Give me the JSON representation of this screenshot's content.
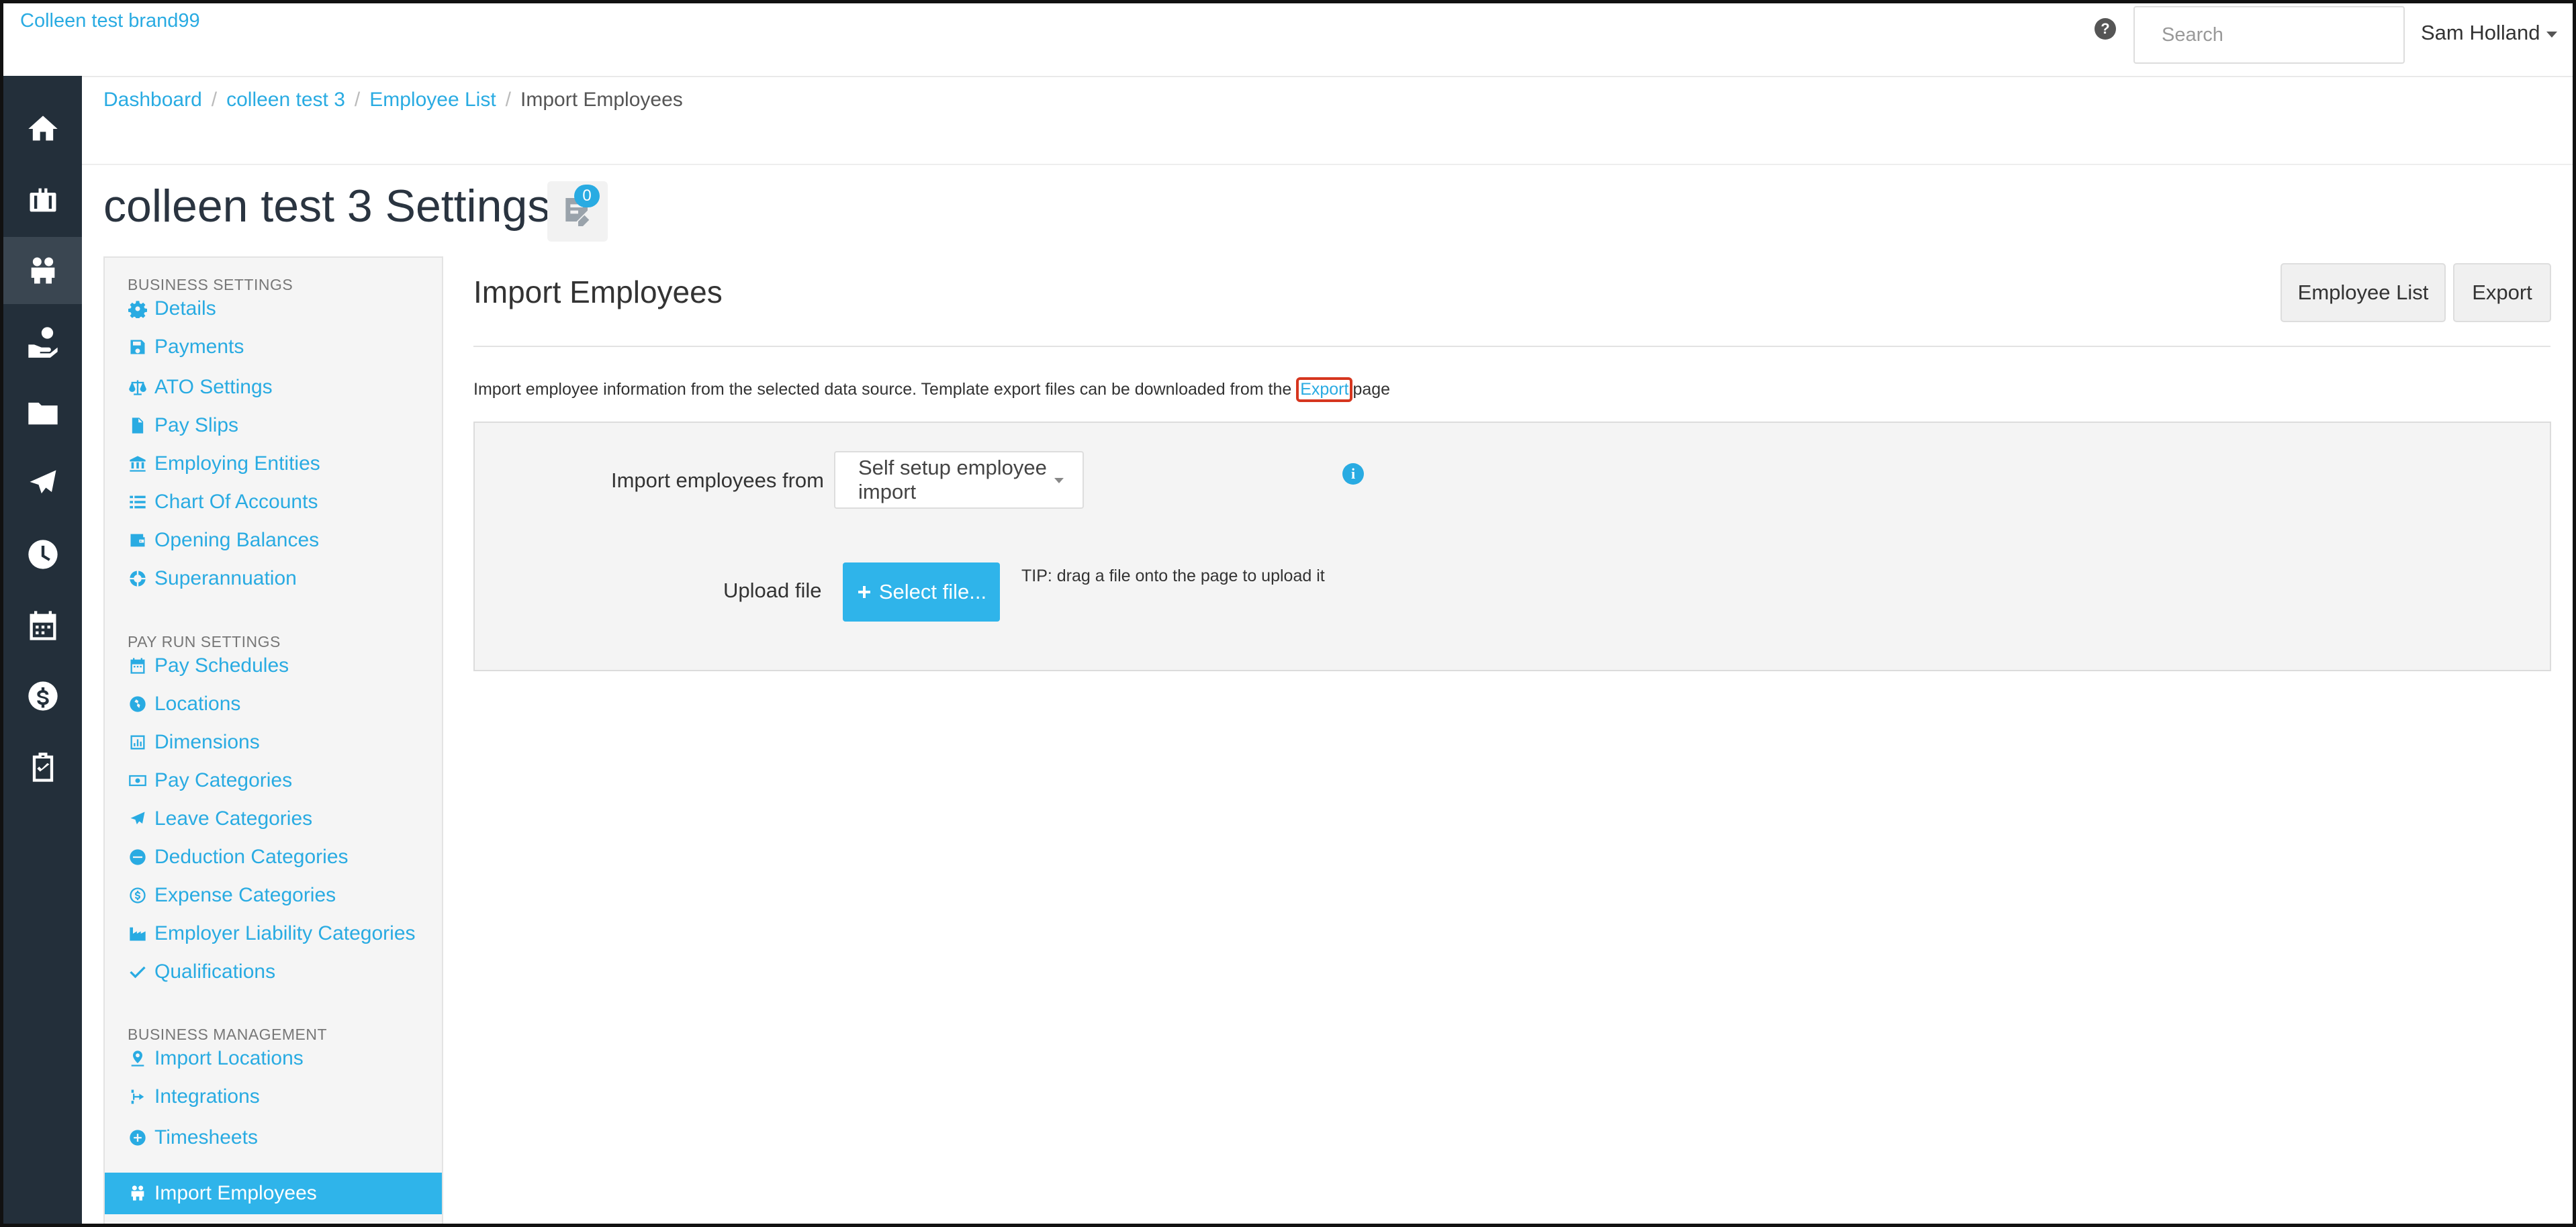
{
  "topbar": {
    "brand": "Colleen test brand99",
    "help_icon": "?",
    "search_placeholder": "Search",
    "user_name": "Sam Holland"
  },
  "rail": {
    "items": [
      {
        "icon": "home-icon"
      },
      {
        "icon": "briefcase-icon"
      },
      {
        "icon": "people-icon",
        "active": true
      },
      {
        "icon": "hand-coin-icon"
      },
      {
        "icon": "folder-icon"
      },
      {
        "icon": "plane-icon"
      },
      {
        "icon": "clock-icon"
      },
      {
        "icon": "calendar-icon"
      },
      {
        "icon": "dollar-icon"
      },
      {
        "icon": "clipboard-check-icon"
      }
    ]
  },
  "breadcrumb": {
    "items": [
      "Dashboard",
      "colleen test 3",
      "Employee List"
    ],
    "current": "Import Employees",
    "separator": "/"
  },
  "page": {
    "title": "colleen test 3 Settings",
    "notes_count": "0"
  },
  "sidebar": {
    "business_settings": {
      "heading": "BUSINESS SETTINGS",
      "items": [
        "Details",
        "Payments",
        "ATO Settings",
        "Pay Slips",
        "Employing Entities",
        "Chart Of Accounts",
        "Opening Balances",
        "Superannuation"
      ]
    },
    "pay_run_settings": {
      "heading": "PAY RUN SETTINGS",
      "items": [
        "Pay Schedules",
        "Locations",
        "Dimensions",
        "Pay Categories",
        "Leave Categories",
        "Deduction Categories",
        "Expense Categories",
        "Employer Liability Categories",
        "Qualifications"
      ]
    },
    "business_management": {
      "heading": "BUSINESS MANAGEMENT",
      "items": [
        "Import Locations",
        "Integrations",
        "Timesheets",
        "Import Employees"
      ]
    }
  },
  "main": {
    "title": "Import Employees",
    "buttons": {
      "employee_list": "Employee List",
      "export": "Export"
    },
    "description_before": "Import employee information from the selected data source. Template export files can be downloaded from the ",
    "description_link": "Export",
    "description_after": "page",
    "form": {
      "import_from_label": "Import employees from",
      "import_from_value": "Self setup employee import",
      "info_icon": "i",
      "upload_label": "Upload file",
      "select_file_label": "Select file...",
      "tip": "TIP: drag a file onto the page to upload it"
    }
  },
  "colors": {
    "accent": "#29abe2",
    "rail_bg": "#232f3a",
    "active_nav": "#2fb4ea",
    "highlight": "#d6361f"
  }
}
